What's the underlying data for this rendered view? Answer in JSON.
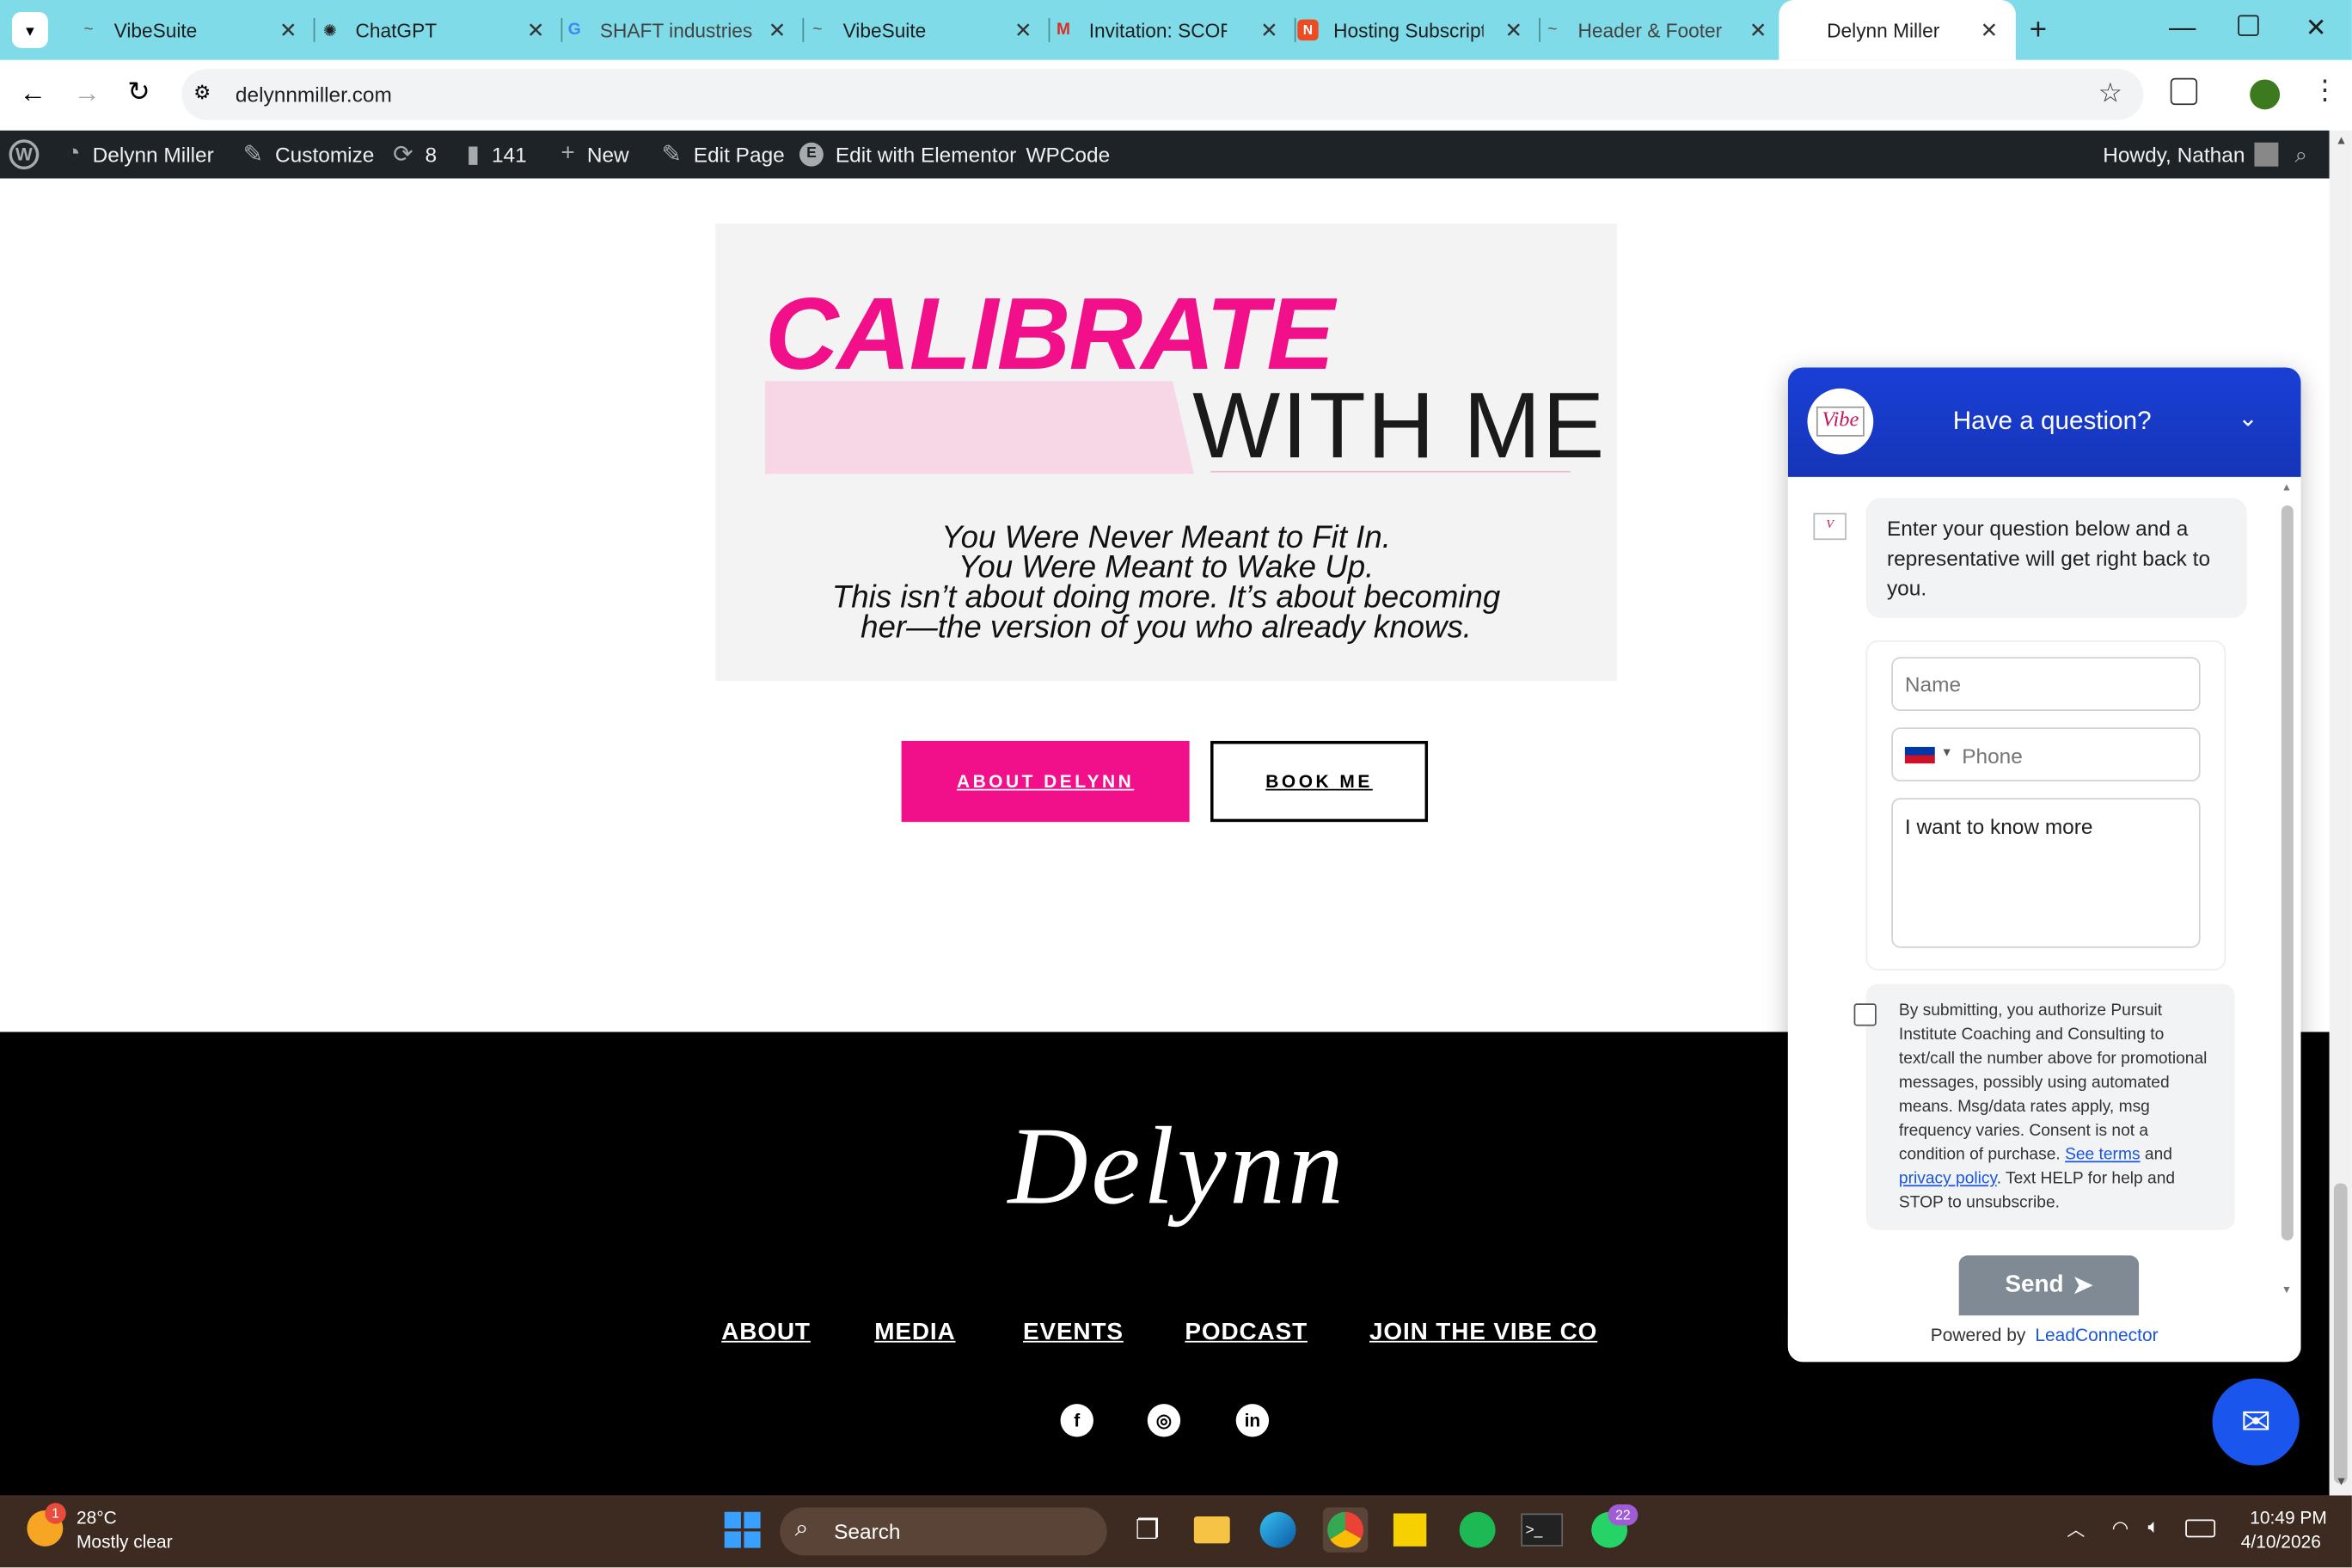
{
  "browser": {
    "tabs": [
      {
        "label": "VibeSuite"
      },
      {
        "label": "ChatGPT"
      },
      {
        "label": "SHAFT industries"
      },
      {
        "label": "VibeSuite"
      },
      {
        "label": "Invitation: SCORM"
      },
      {
        "label": "Hosting Subscripti"
      },
      {
        "label": "Header & Footer"
      },
      {
        "label": "Delynn Miller"
      }
    ],
    "url": "delynnmiller.com"
  },
  "wp_admin": {
    "site_name": "Delynn Miller",
    "customize": "Customize",
    "updates": "8",
    "comments": "141",
    "new": "New",
    "edit_page": "Edit Page",
    "edit_elementor": "Edit with Elementor",
    "wpcode": "WPCode",
    "howdy": "Howdy, Nathan"
  },
  "hero": {
    "calibrate": "CALIBRATE",
    "with_me": "WITH ME",
    "line1": "You Were Never Meant to Fit In.",
    "line2": "You Were Meant to Wake Up.",
    "line3": "This isn’t about doing more. It’s about becoming",
    "line4": "her—the version of you who already knows."
  },
  "buttons": {
    "about": "ABOUT DELYNN",
    "book": "BOOK ME"
  },
  "footer": {
    "signature": "Delynn",
    "nav": [
      "ABOUT",
      "MEDIA",
      "EVENTS",
      "PODCAST",
      "JOIN THE VIBE CO"
    ]
  },
  "chat": {
    "header": "Have a question?",
    "logo_text": "Vibe",
    "intro": "Enter your question below and a representative will get right back to you.",
    "name_placeholder": "Name",
    "phone_placeholder": "Phone",
    "message_value": "I want to know more",
    "consent_1": "By submitting, you authorize Pursuit Institute Coaching and Consulting to text/call the number above for promotional messages, possibly using automated means. Msg/data rates apply, msg frequency varies. Consent is not a condition of purchase.",
    "see_terms": "See terms",
    "and": "and",
    "privacy": "privacy policy",
    "consent_2": ". Text HELP for help and STOP to unsubscribe.",
    "send": "Send",
    "powered_by": "Powered by",
    "powered_link": "LeadConnector"
  },
  "taskbar": {
    "temp": "28°C",
    "weather": "Mostly clear",
    "weather_badge": "1",
    "search": "Search",
    "whatsapp_badge": "22",
    "time": "10:49 PM",
    "date": "4/10/2026"
  },
  "colors": {
    "accent_pink": "#f20f8a",
    "tabbar": "#7fdbe8",
    "chat_blue": "#1a3fd6",
    "send_gray": "#7f8a94"
  }
}
